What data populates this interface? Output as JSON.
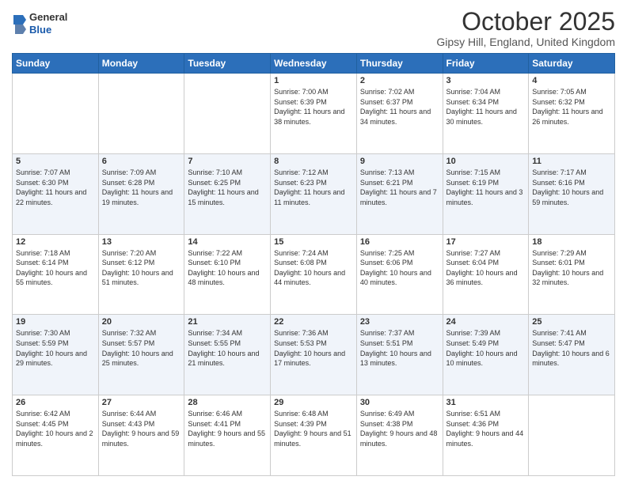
{
  "header": {
    "logo": {
      "general": "General",
      "blue": "Blue"
    },
    "month": "October 2025",
    "location": "Gipsy Hill, England, United Kingdom"
  },
  "days_of_week": [
    "Sunday",
    "Monday",
    "Tuesday",
    "Wednesday",
    "Thursday",
    "Friday",
    "Saturday"
  ],
  "weeks": [
    [
      {
        "day": "",
        "sunrise": "",
        "sunset": "",
        "daylight": ""
      },
      {
        "day": "",
        "sunrise": "",
        "sunset": "",
        "daylight": ""
      },
      {
        "day": "",
        "sunrise": "",
        "sunset": "",
        "daylight": ""
      },
      {
        "day": "1",
        "sunrise": "Sunrise: 7:00 AM",
        "sunset": "Sunset: 6:39 PM",
        "daylight": "Daylight: 11 hours and 38 minutes."
      },
      {
        "day": "2",
        "sunrise": "Sunrise: 7:02 AM",
        "sunset": "Sunset: 6:37 PM",
        "daylight": "Daylight: 11 hours and 34 minutes."
      },
      {
        "day": "3",
        "sunrise": "Sunrise: 7:04 AM",
        "sunset": "Sunset: 6:34 PM",
        "daylight": "Daylight: 11 hours and 30 minutes."
      },
      {
        "day": "4",
        "sunrise": "Sunrise: 7:05 AM",
        "sunset": "Sunset: 6:32 PM",
        "daylight": "Daylight: 11 hours and 26 minutes."
      }
    ],
    [
      {
        "day": "5",
        "sunrise": "Sunrise: 7:07 AM",
        "sunset": "Sunset: 6:30 PM",
        "daylight": "Daylight: 11 hours and 22 minutes."
      },
      {
        "day": "6",
        "sunrise": "Sunrise: 7:09 AM",
        "sunset": "Sunset: 6:28 PM",
        "daylight": "Daylight: 11 hours and 19 minutes."
      },
      {
        "day": "7",
        "sunrise": "Sunrise: 7:10 AM",
        "sunset": "Sunset: 6:25 PM",
        "daylight": "Daylight: 11 hours and 15 minutes."
      },
      {
        "day": "8",
        "sunrise": "Sunrise: 7:12 AM",
        "sunset": "Sunset: 6:23 PM",
        "daylight": "Daylight: 11 hours and 11 minutes."
      },
      {
        "day": "9",
        "sunrise": "Sunrise: 7:13 AM",
        "sunset": "Sunset: 6:21 PM",
        "daylight": "Daylight: 11 hours and 7 minutes."
      },
      {
        "day": "10",
        "sunrise": "Sunrise: 7:15 AM",
        "sunset": "Sunset: 6:19 PM",
        "daylight": "Daylight: 11 hours and 3 minutes."
      },
      {
        "day": "11",
        "sunrise": "Sunrise: 7:17 AM",
        "sunset": "Sunset: 6:16 PM",
        "daylight": "Daylight: 10 hours and 59 minutes."
      }
    ],
    [
      {
        "day": "12",
        "sunrise": "Sunrise: 7:18 AM",
        "sunset": "Sunset: 6:14 PM",
        "daylight": "Daylight: 10 hours and 55 minutes."
      },
      {
        "day": "13",
        "sunrise": "Sunrise: 7:20 AM",
        "sunset": "Sunset: 6:12 PM",
        "daylight": "Daylight: 10 hours and 51 minutes."
      },
      {
        "day": "14",
        "sunrise": "Sunrise: 7:22 AM",
        "sunset": "Sunset: 6:10 PM",
        "daylight": "Daylight: 10 hours and 48 minutes."
      },
      {
        "day": "15",
        "sunrise": "Sunrise: 7:24 AM",
        "sunset": "Sunset: 6:08 PM",
        "daylight": "Daylight: 10 hours and 44 minutes."
      },
      {
        "day": "16",
        "sunrise": "Sunrise: 7:25 AM",
        "sunset": "Sunset: 6:06 PM",
        "daylight": "Daylight: 10 hours and 40 minutes."
      },
      {
        "day": "17",
        "sunrise": "Sunrise: 7:27 AM",
        "sunset": "Sunset: 6:04 PM",
        "daylight": "Daylight: 10 hours and 36 minutes."
      },
      {
        "day": "18",
        "sunrise": "Sunrise: 7:29 AM",
        "sunset": "Sunset: 6:01 PM",
        "daylight": "Daylight: 10 hours and 32 minutes."
      }
    ],
    [
      {
        "day": "19",
        "sunrise": "Sunrise: 7:30 AM",
        "sunset": "Sunset: 5:59 PM",
        "daylight": "Daylight: 10 hours and 29 minutes."
      },
      {
        "day": "20",
        "sunrise": "Sunrise: 7:32 AM",
        "sunset": "Sunset: 5:57 PM",
        "daylight": "Daylight: 10 hours and 25 minutes."
      },
      {
        "day": "21",
        "sunrise": "Sunrise: 7:34 AM",
        "sunset": "Sunset: 5:55 PM",
        "daylight": "Daylight: 10 hours and 21 minutes."
      },
      {
        "day": "22",
        "sunrise": "Sunrise: 7:36 AM",
        "sunset": "Sunset: 5:53 PM",
        "daylight": "Daylight: 10 hours and 17 minutes."
      },
      {
        "day": "23",
        "sunrise": "Sunrise: 7:37 AM",
        "sunset": "Sunset: 5:51 PM",
        "daylight": "Daylight: 10 hours and 13 minutes."
      },
      {
        "day": "24",
        "sunrise": "Sunrise: 7:39 AM",
        "sunset": "Sunset: 5:49 PM",
        "daylight": "Daylight: 10 hours and 10 minutes."
      },
      {
        "day": "25",
        "sunrise": "Sunrise: 7:41 AM",
        "sunset": "Sunset: 5:47 PM",
        "daylight": "Daylight: 10 hours and 6 minutes."
      }
    ],
    [
      {
        "day": "26",
        "sunrise": "Sunrise: 6:42 AM",
        "sunset": "Sunset: 4:45 PM",
        "daylight": "Daylight: 10 hours and 2 minutes."
      },
      {
        "day": "27",
        "sunrise": "Sunrise: 6:44 AM",
        "sunset": "Sunset: 4:43 PM",
        "daylight": "Daylight: 9 hours and 59 minutes."
      },
      {
        "day": "28",
        "sunrise": "Sunrise: 6:46 AM",
        "sunset": "Sunset: 4:41 PM",
        "daylight": "Daylight: 9 hours and 55 minutes."
      },
      {
        "day": "29",
        "sunrise": "Sunrise: 6:48 AM",
        "sunset": "Sunset: 4:39 PM",
        "daylight": "Daylight: 9 hours and 51 minutes."
      },
      {
        "day": "30",
        "sunrise": "Sunrise: 6:49 AM",
        "sunset": "Sunset: 4:38 PM",
        "daylight": "Daylight: 9 hours and 48 minutes."
      },
      {
        "day": "31",
        "sunrise": "Sunrise: 6:51 AM",
        "sunset": "Sunset: 4:36 PM",
        "daylight": "Daylight: 9 hours and 44 minutes."
      },
      {
        "day": "",
        "sunrise": "",
        "sunset": "",
        "daylight": ""
      }
    ]
  ]
}
